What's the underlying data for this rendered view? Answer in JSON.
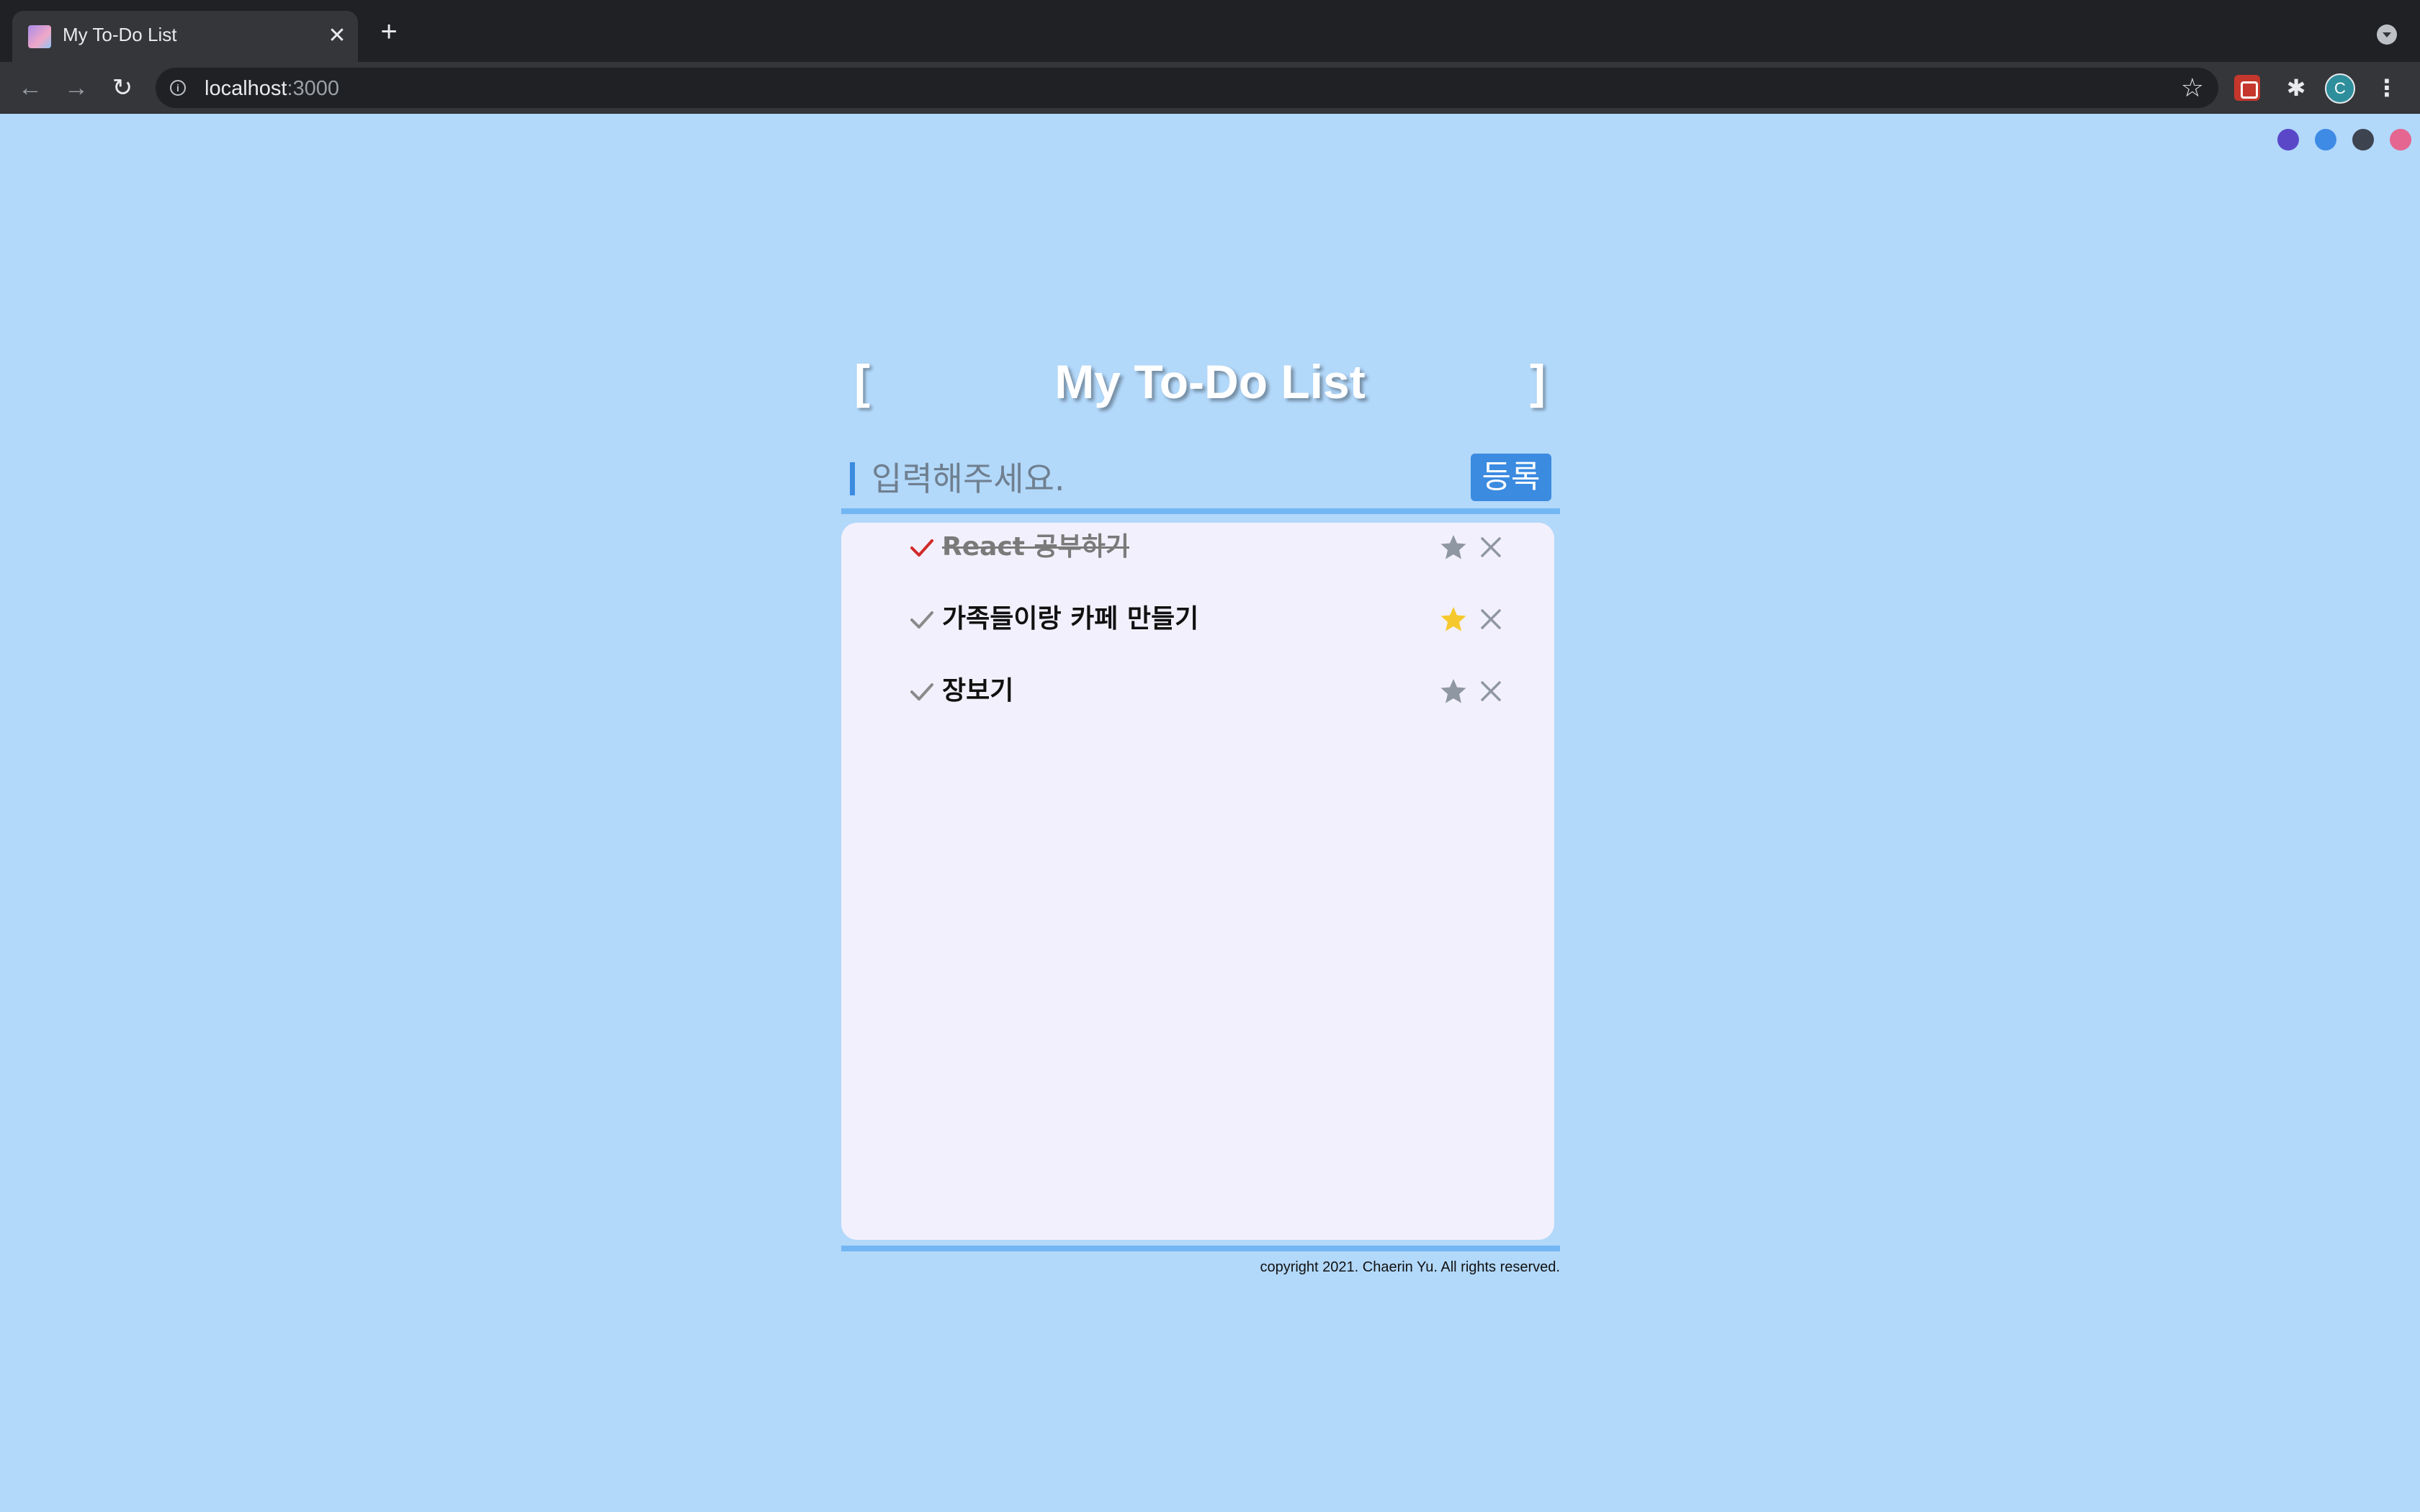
{
  "browser": {
    "tab_title": "My To-Do List",
    "tab_close_icon": "close-icon",
    "new_tab_icon": "plus-icon",
    "url_host": "localhost",
    "url_port": ":3000",
    "avatar_initial": "C"
  },
  "theme_colors": [
    "#5a47c8",
    "#3d8be4",
    "#3d4450",
    "#e56690"
  ],
  "app": {
    "bracket_left": "[",
    "bracket_right": "]",
    "title": "My To-Do List",
    "input_placeholder": "입력해주세요.",
    "input_value": "",
    "add_button_label": "등록",
    "copyright": "copyright 2021. Chaerin Yu. All rights reserved."
  },
  "todos": [
    {
      "text": "React 공부하기",
      "done": true,
      "starred": false
    },
    {
      "text": "가족들이랑 카페 만들기",
      "done": false,
      "starred": true
    },
    {
      "text": "장보기",
      "done": false,
      "starred": false
    }
  ],
  "colors": {
    "background": "#b2d8fa",
    "accent": "#3b8be0",
    "panel": "#f3f0fd",
    "check_done": "#d12a2a",
    "check_idle": "#8a8a8a",
    "star_on": "#f5c92e",
    "star_off": "#8f97a3"
  }
}
